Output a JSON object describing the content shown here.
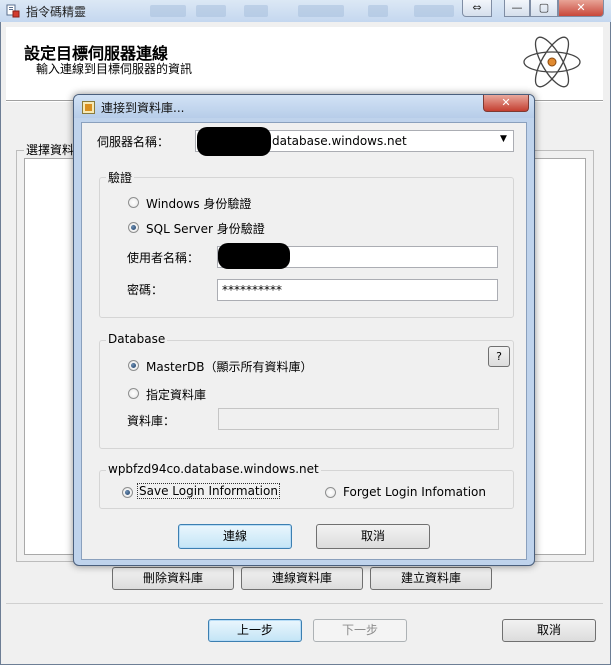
{
  "window": {
    "title": "指令碼精靈",
    "help_glyph": "⇔",
    "min_glyph": "—",
    "max_glyph": "▢",
    "close_glyph": "✕"
  },
  "header": {
    "title": "設定目標伺服器連線",
    "subtitle": "輸入連線到目標伺服器的資訊"
  },
  "background": {
    "select_db_label": "選擇資料",
    "buttons": {
      "delete_db": "刪除資料庫",
      "connect_db": "連線資料庫",
      "create_db": "建立資料庫"
    }
  },
  "footer": {
    "back": "上一步",
    "next": "下一步",
    "cancel": "取消"
  },
  "dialog": {
    "title": "連接到資料庫...",
    "close_glyph": "✕",
    "server_label": "伺服器名稱：",
    "server_value": "database.windows.net",
    "auth_group": "驗證",
    "auth_windows": "Windows 身份驗證",
    "auth_sql": "SQL Server 身份驗證",
    "username_label": "使用者名稱：",
    "password_label": "密碼：",
    "password_value": "**********",
    "database_group": "Database",
    "help_glyph": "?",
    "master_db": "MasterDB（顯示所有資料庫）",
    "specify_db": "指定資料庫",
    "db_label": "資料庫：",
    "login_group": "wpbfzd94co.database.windows.net",
    "save_login": "Save Login Information",
    "forget_login": "Forget Login Infomation",
    "connect": "連線",
    "cancel": "取消"
  },
  "colors": {
    "titlebar": "#c4d7ef",
    "close_red": "#c8473a",
    "dialog_frame": "#bfd3ec",
    "panel": "#f0f0f0"
  }
}
